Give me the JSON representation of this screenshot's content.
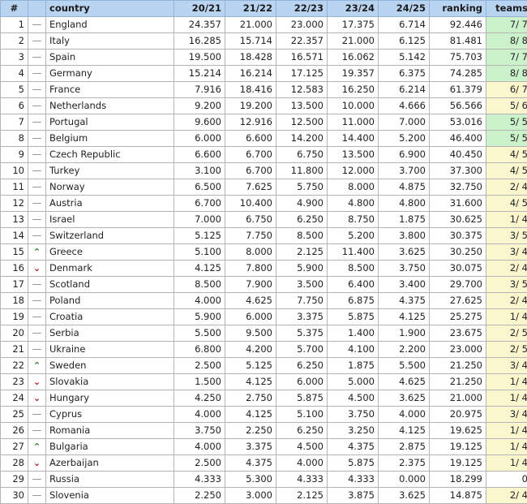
{
  "table": {
    "name": "uefa-country-coefficients",
    "columns": [
      {
        "key": "rank",
        "label": "#"
      },
      {
        "key": "move",
        "label": ""
      },
      {
        "key": "country",
        "label": "country"
      },
      {
        "key": "s2021",
        "label": "20/21"
      },
      {
        "key": "s2122",
        "label": "21/22"
      },
      {
        "key": "s2223",
        "label": "22/23"
      },
      {
        "key": "s2324",
        "label": "23/24"
      },
      {
        "key": "s2425",
        "label": "24/25"
      },
      {
        "key": "ranking",
        "label": "ranking"
      },
      {
        "key": "teams",
        "label": "teams"
      }
    ],
    "colors": {
      "header_background": "#b9d4f1",
      "teams_full_background": "#ccf2cc",
      "teams_partial_background": "#faf7cf",
      "move_up_color": "#1c7a1c",
      "move_down_color": "#aa1111",
      "move_same_color": "#8a8a8a",
      "border_color": "#b4b4b4"
    },
    "move_glyphs": {
      "same": "—",
      "up": "⌃",
      "down": "⌄"
    },
    "rows": [
      {
        "rank": "1",
        "move": "same",
        "country": "England",
        "s2021": "24.357",
        "s2122": "21.000",
        "s2223": "23.000",
        "s2324": "17.375",
        "s2425": "6.714",
        "ranking": "92.446",
        "teams": "7/ 7",
        "teams_state": "full"
      },
      {
        "rank": "2",
        "move": "same",
        "country": "Italy",
        "s2021": "16.285",
        "s2122": "15.714",
        "s2223": "22.357",
        "s2324": "21.000",
        "s2425": "6.125",
        "ranking": "81.481",
        "teams": "8/ 8",
        "teams_state": "full"
      },
      {
        "rank": "3",
        "move": "same",
        "country": "Spain",
        "s2021": "19.500",
        "s2122": "18.428",
        "s2223": "16.571",
        "s2324": "16.062",
        "s2425": "5.142",
        "ranking": "75.703",
        "teams": "7/ 7",
        "teams_state": "full"
      },
      {
        "rank": "4",
        "move": "same",
        "country": "Germany",
        "s2021": "15.214",
        "s2122": "16.214",
        "s2223": "17.125",
        "s2324": "19.357",
        "s2425": "6.375",
        "ranking": "74.285",
        "teams": "8/ 8",
        "teams_state": "full"
      },
      {
        "rank": "5",
        "move": "same",
        "country": "France",
        "s2021": "7.916",
        "s2122": "18.416",
        "s2223": "12.583",
        "s2324": "16.250",
        "s2425": "6.214",
        "ranking": "61.379",
        "teams": "6/ 7",
        "teams_state": "partial"
      },
      {
        "rank": "6",
        "move": "same",
        "country": "Netherlands",
        "s2021": "9.200",
        "s2122": "19.200",
        "s2223": "13.500",
        "s2324": "10.000",
        "s2425": "4.666",
        "ranking": "56.566",
        "teams": "5/ 6",
        "teams_state": "partial"
      },
      {
        "rank": "7",
        "move": "same",
        "country": "Portugal",
        "s2021": "9.600",
        "s2122": "12.916",
        "s2223": "12.500",
        "s2324": "11.000",
        "s2425": "7.000",
        "ranking": "53.016",
        "teams": "5/ 5",
        "teams_state": "full"
      },
      {
        "rank": "8",
        "move": "same",
        "country": "Belgium",
        "s2021": "6.000",
        "s2122": "6.600",
        "s2223": "14.200",
        "s2324": "14.400",
        "s2425": "5.200",
        "ranking": "46.400",
        "teams": "5/ 5",
        "teams_state": "full"
      },
      {
        "rank": "9",
        "move": "same",
        "country": "Czech Republic",
        "s2021": "6.600",
        "s2122": "6.700",
        "s2223": "6.750",
        "s2324": "13.500",
        "s2425": "6.900",
        "ranking": "40.450",
        "teams": "4/ 5",
        "teams_state": "partial"
      },
      {
        "rank": "10",
        "move": "same",
        "country": "Turkey",
        "s2021": "3.100",
        "s2122": "6.700",
        "s2223": "11.800",
        "s2324": "12.000",
        "s2425": "3.700",
        "ranking": "37.300",
        "teams": "4/ 5",
        "teams_state": "partial"
      },
      {
        "rank": "11",
        "move": "same",
        "country": "Norway",
        "s2021": "6.500",
        "s2122": "7.625",
        "s2223": "5.750",
        "s2324": "8.000",
        "s2425": "4.875",
        "ranking": "32.750",
        "teams": "2/ 4",
        "teams_state": "partial"
      },
      {
        "rank": "12",
        "move": "same",
        "country": "Austria",
        "s2021": "6.700",
        "s2122": "10.400",
        "s2223": "4.900",
        "s2324": "4.800",
        "s2425": "4.800",
        "ranking": "31.600",
        "teams": "4/ 5",
        "teams_state": "partial"
      },
      {
        "rank": "13",
        "move": "same",
        "country": "Israel",
        "s2021": "7.000",
        "s2122": "6.750",
        "s2223": "6.250",
        "s2324": "8.750",
        "s2425": "1.875",
        "ranking": "30.625",
        "teams": "1/ 4",
        "teams_state": "partial"
      },
      {
        "rank": "14",
        "move": "same",
        "country": "Switzerland",
        "s2021": "5.125",
        "s2122": "7.750",
        "s2223": "8.500",
        "s2324": "5.200",
        "s2425": "3.800",
        "ranking": "30.375",
        "teams": "3/ 5",
        "teams_state": "partial"
      },
      {
        "rank": "15",
        "move": "up",
        "country": "Greece",
        "s2021": "5.100",
        "s2122": "8.000",
        "s2223": "2.125",
        "s2324": "11.400",
        "s2425": "3.625",
        "ranking": "30.250",
        "teams": "3/ 4",
        "teams_state": "partial"
      },
      {
        "rank": "16",
        "move": "down",
        "country": "Denmark",
        "s2021": "4.125",
        "s2122": "7.800",
        "s2223": "5.900",
        "s2324": "8.500",
        "s2425": "3.750",
        "ranking": "30.075",
        "teams": "2/ 4",
        "teams_state": "partial"
      },
      {
        "rank": "17",
        "move": "same",
        "country": "Scotland",
        "s2021": "8.500",
        "s2122": "7.900",
        "s2223": "3.500",
        "s2324": "6.400",
        "s2425": "3.400",
        "ranking": "29.700",
        "teams": "3/ 5",
        "teams_state": "partial"
      },
      {
        "rank": "18",
        "move": "same",
        "country": "Poland",
        "s2021": "4.000",
        "s2122": "4.625",
        "s2223": "7.750",
        "s2324": "6.875",
        "s2425": "4.375",
        "ranking": "27.625",
        "teams": "2/ 4",
        "teams_state": "partial"
      },
      {
        "rank": "19",
        "move": "same",
        "country": "Croatia",
        "s2021": "5.900",
        "s2122": "6.000",
        "s2223": "3.375",
        "s2324": "5.875",
        "s2425": "4.125",
        "ranking": "25.275",
        "teams": "1/ 4",
        "teams_state": "partial"
      },
      {
        "rank": "20",
        "move": "same",
        "country": "Serbia",
        "s2021": "5.500",
        "s2122": "9.500",
        "s2223": "5.375",
        "s2324": "1.400",
        "s2425": "1.900",
        "ranking": "23.675",
        "teams": "2/ 5",
        "teams_state": "partial"
      },
      {
        "rank": "21",
        "move": "same",
        "country": "Ukraine",
        "s2021": "6.800",
        "s2122": "4.200",
        "s2223": "5.700",
        "s2324": "4.100",
        "s2425": "2.200",
        "ranking": "23.000",
        "teams": "2/ 5",
        "teams_state": "partial"
      },
      {
        "rank": "22",
        "move": "up",
        "country": "Sweden",
        "s2021": "2.500",
        "s2122": "5.125",
        "s2223": "6.250",
        "s2324": "1.875",
        "s2425": "5.500",
        "ranking": "21.250",
        "teams": "3/ 4",
        "teams_state": "partial"
      },
      {
        "rank": "23",
        "move": "down",
        "country": "Slovakia",
        "s2021": "1.500",
        "s2122": "4.125",
        "s2223": "6.000",
        "s2324": "5.000",
        "s2425": "4.625",
        "ranking": "21.250",
        "teams": "1/ 4",
        "teams_state": "partial"
      },
      {
        "rank": "24",
        "move": "down",
        "country": "Hungary",
        "s2021": "4.250",
        "s2122": "2.750",
        "s2223": "5.875",
        "s2324": "4.500",
        "s2425": "3.625",
        "ranking": "21.000",
        "teams": "1/ 4",
        "teams_state": "partial"
      },
      {
        "rank": "25",
        "move": "same",
        "country": "Cyprus",
        "s2021": "4.000",
        "s2122": "4.125",
        "s2223": "5.100",
        "s2324": "3.750",
        "s2425": "4.000",
        "ranking": "20.975",
        "teams": "3/ 4",
        "teams_state": "partial"
      },
      {
        "rank": "26",
        "move": "same",
        "country": "Romania",
        "s2021": "3.750",
        "s2122": "2.250",
        "s2223": "6.250",
        "s2324": "3.250",
        "s2425": "4.125",
        "ranking": "19.625",
        "teams": "1/ 4",
        "teams_state": "partial"
      },
      {
        "rank": "27",
        "move": "up",
        "country": "Bulgaria",
        "s2021": "4.000",
        "s2122": "3.375",
        "s2223": "4.500",
        "s2324": "4.375",
        "s2425": "2.875",
        "ranking": "19.125",
        "teams": "1/ 4",
        "teams_state": "partial"
      },
      {
        "rank": "28",
        "move": "down",
        "country": "Azerbaijan",
        "s2021": "2.500",
        "s2122": "4.375",
        "s2223": "4.000",
        "s2324": "5.875",
        "s2425": "2.375",
        "ranking": "19.125",
        "teams": "1/ 4",
        "teams_state": "partial"
      },
      {
        "rank": "29",
        "move": "same",
        "country": "Russia",
        "s2021": "4.333",
        "s2122": "5.300",
        "s2223": "4.333",
        "s2324": "4.333",
        "s2425": "0.000",
        "ranking": "18.299",
        "teams": "0",
        "teams_state": "none"
      },
      {
        "rank": "30",
        "move": "same",
        "country": "Slovenia",
        "s2021": "2.250",
        "s2122": "3.000",
        "s2223": "2.125",
        "s2324": "3.875",
        "s2425": "3.625",
        "ranking": "14.875",
        "teams": "2/ 4",
        "teams_state": "partial"
      }
    ]
  }
}
